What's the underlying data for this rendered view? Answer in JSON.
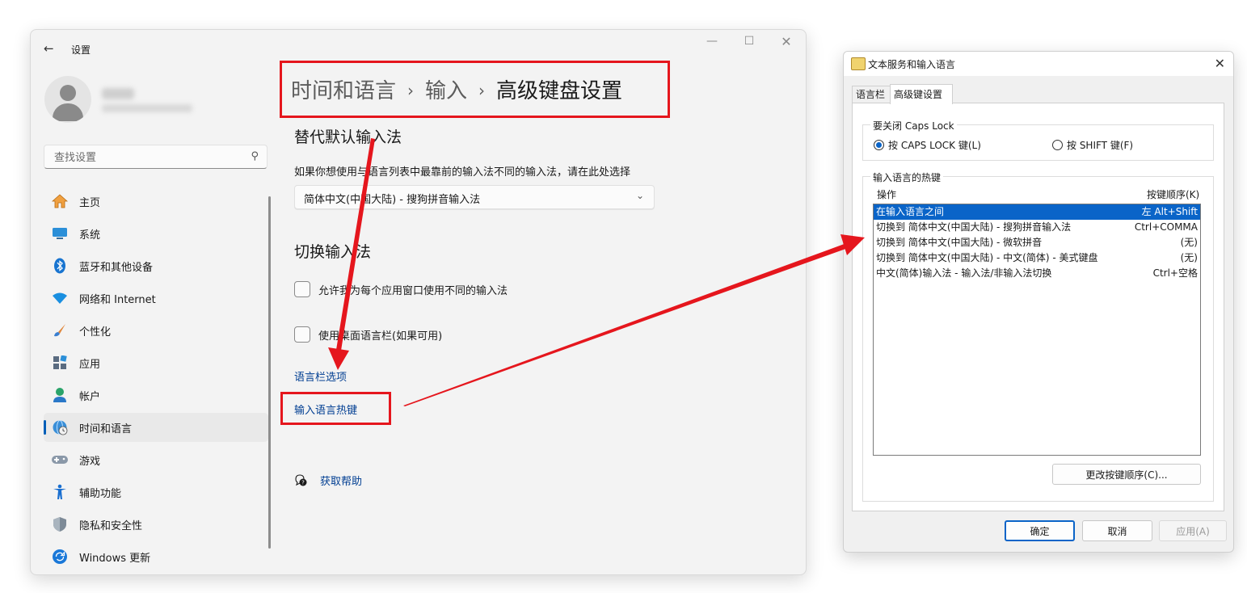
{
  "settings": {
    "window_title": "设置",
    "search_placeholder": "查找设置",
    "nav": [
      {
        "label": "主页",
        "icon": "home-icon"
      },
      {
        "label": "系统",
        "icon": "monitor-icon"
      },
      {
        "label": "蓝牙和其他设备",
        "icon": "bluetooth-icon"
      },
      {
        "label": "网络和 Internet",
        "icon": "wifi-icon"
      },
      {
        "label": "个性化",
        "icon": "brush-icon"
      },
      {
        "label": "应用",
        "icon": "apps-icon"
      },
      {
        "label": "帐户",
        "icon": "account-icon"
      },
      {
        "label": "时间和语言",
        "icon": "globe-clock-icon",
        "selected": true
      },
      {
        "label": "游戏",
        "icon": "gamepad-icon"
      },
      {
        "label": "辅助功能",
        "icon": "accessibility-icon"
      },
      {
        "label": "隐私和安全性",
        "icon": "shield-icon"
      },
      {
        "label": "Windows 更新",
        "icon": "update-icon"
      }
    ],
    "breadcrumb": [
      "时间和语言",
      "输入",
      "高级键盘设置"
    ],
    "section1_title": "替代默认输入法",
    "section1_desc": "如果你想使用与语言列表中最靠前的输入法不同的输入法，请在此处选择",
    "dropdown_value": "简体中文(中国大陆) - 搜狗拼音输入法",
    "section2_title": "切换输入法",
    "checkbox1": "允许我为每个应用窗口使用不同的输入法",
    "checkbox2": "使用桌面语言栏(如果可用)",
    "link_language_bar": "语言栏选项",
    "link_hotkeys": "输入语言热键",
    "help_link": "获取帮助"
  },
  "dialog": {
    "title": "文本服务和输入语言",
    "tabs": [
      "语言栏",
      "高级键设置"
    ],
    "capslock_group": "要关闭 Caps Lock",
    "radio_capslock": "按 CAPS LOCK 键(L)",
    "radio_shift": "按 SHIFT 键(F)",
    "hotkey_group": "输入语言的热键",
    "col_action": "操作",
    "col_key": "按键顺序(K)",
    "rows": [
      {
        "action": "在输入语言之间",
        "key": "左 Alt+Shift",
        "selected": true
      },
      {
        "action": "切换到 简体中文(中国大陆) - 搜狗拼音输入法",
        "key": "Ctrl+COMMA"
      },
      {
        "action": "切换到 简体中文(中国大陆) - 微软拼音",
        "key": "(无)"
      },
      {
        "action": "切换到 简体中文(中国大陆) - 中文(简体) - 美式键盘",
        "key": "(无)"
      },
      {
        "action": "中文(简体)输入法 - 输入法/非输入法切换",
        "key": "Ctrl+空格"
      }
    ],
    "change_key_button": "更改按键顺序(C)...",
    "ok": "确定",
    "cancel": "取消",
    "apply": "应用(A)"
  },
  "colors": {
    "accent": "#005fb8",
    "link": "#003e92",
    "annotation_red": "#e5161d",
    "list_selection": "#0a64c8"
  }
}
